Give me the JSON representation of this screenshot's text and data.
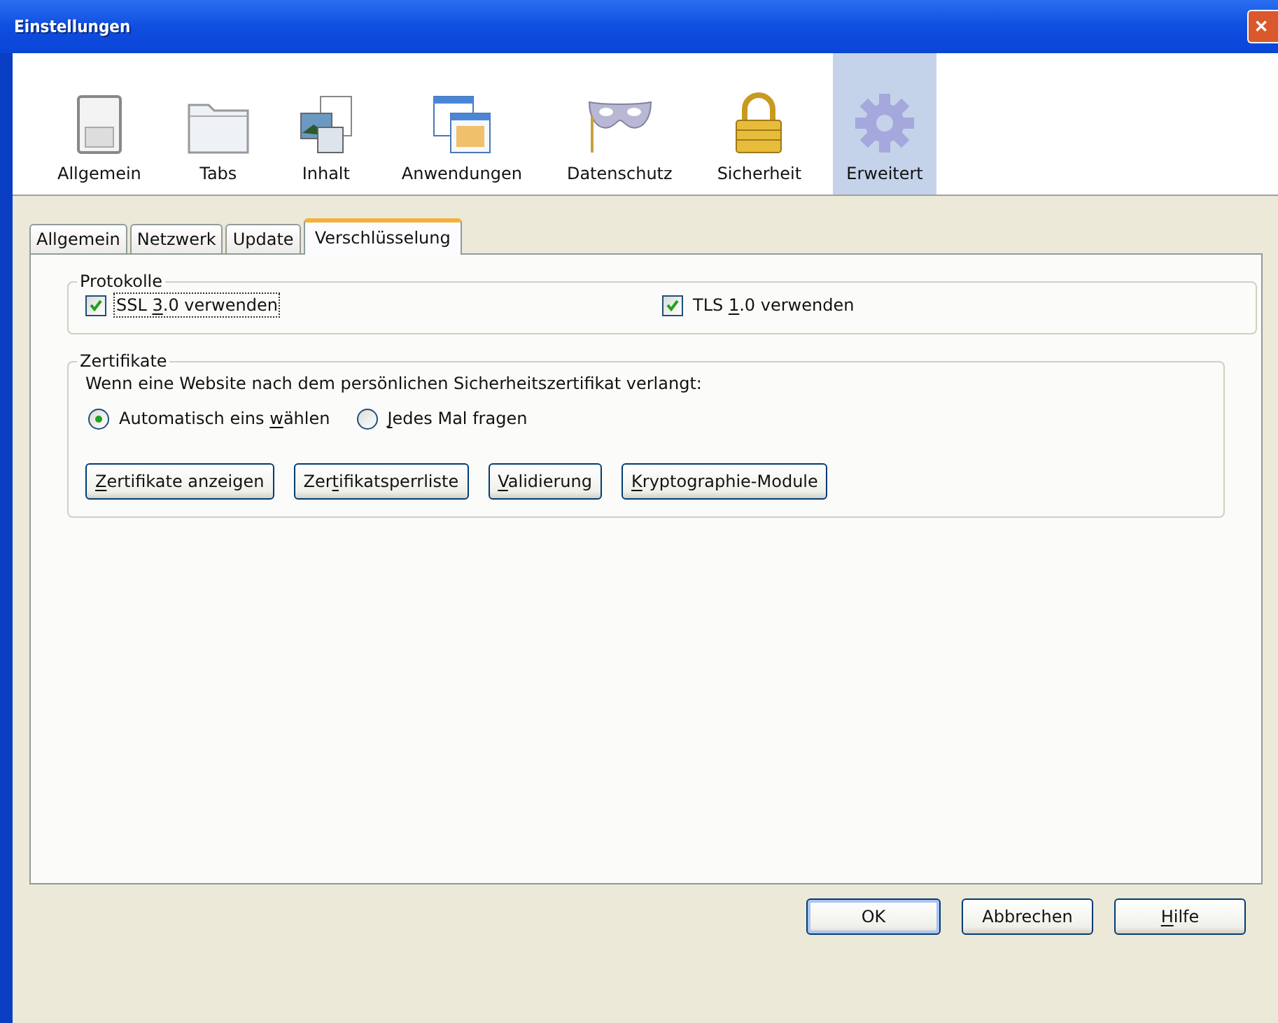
{
  "window": {
    "title": "Einstellungen",
    "close": "✕"
  },
  "toolbar": [
    {
      "label": "Allgemein",
      "selected": false
    },
    {
      "label": "Tabs",
      "selected": false
    },
    {
      "label": "Inhalt",
      "selected": false
    },
    {
      "label": "Anwendungen",
      "selected": false
    },
    {
      "label": "Datenschutz",
      "selected": false
    },
    {
      "label": "Sicherheit",
      "selected": false
    },
    {
      "label": "Erweitert",
      "selected": true
    }
  ],
  "tabs": [
    {
      "label": "Allgemein",
      "selected": false
    },
    {
      "label": "Netzwerk",
      "selected": false
    },
    {
      "label": "Update",
      "selected": false
    },
    {
      "label": "Verschlüsselung",
      "selected": true
    }
  ],
  "protocols": {
    "title": "Protokolle",
    "options": [
      {
        "label": [
          {
            "text": "SSL ",
            "underline": false
          },
          {
            "text": "3",
            "underline": true
          },
          {
            "text": ".0 verwenden",
            "underline": false
          }
        ],
        "checked": true,
        "focused": true
      },
      {
        "label": [
          {
            "text": "TLS ",
            "underline": false
          },
          {
            "text": "1",
            "underline": true
          },
          {
            "text": ".0 verwenden",
            "underline": false
          }
        ],
        "checked": true,
        "focused": false
      }
    ]
  },
  "certificates": {
    "title": "Zertifikate",
    "prompt": "Wenn eine Website nach dem persönlichen Sicherheitszertifikat verlangt:",
    "choices": [
      {
        "label": [
          {
            "text": "Automatisch eins ",
            "underline": false
          },
          {
            "text": "w",
            "underline": true
          },
          {
            "text": "ählen",
            "underline": false
          }
        ],
        "selected": true
      },
      {
        "label": [
          {
            "text": "J",
            "underline": true
          },
          {
            "text": "edes Mal fragen",
            "underline": false
          }
        ],
        "selected": false
      }
    ],
    "buttons": [
      {
        "label": [
          {
            "text": "Z",
            "underline": true
          },
          {
            "text": "ertifikate anzeigen",
            "underline": false
          }
        ]
      },
      {
        "label": [
          {
            "text": "Zer",
            "underline": false
          },
          {
            "text": "t",
            "underline": true
          },
          {
            "text": "ifikatsperrliste",
            "underline": false
          }
        ]
      },
      {
        "label": [
          {
            "text": "V",
            "underline": true
          },
          {
            "text": "alidierung",
            "underline": false
          }
        ]
      },
      {
        "label": [
          {
            "text": "K",
            "underline": true
          },
          {
            "text": "ryptographie-Module",
            "underline": false
          }
        ]
      }
    ]
  },
  "dialog_buttons": [
    {
      "label": [
        {
          "text": "OK",
          "underline": false
        }
      ],
      "default": true
    },
    {
      "label": [
        {
          "text": "Abbrechen",
          "underline": false
        }
      ],
      "default": false
    },
    {
      "label": [
        {
          "text": "H",
          "underline": true
        },
        {
          "text": "ilfe",
          "underline": false
        }
      ],
      "default": false
    }
  ]
}
